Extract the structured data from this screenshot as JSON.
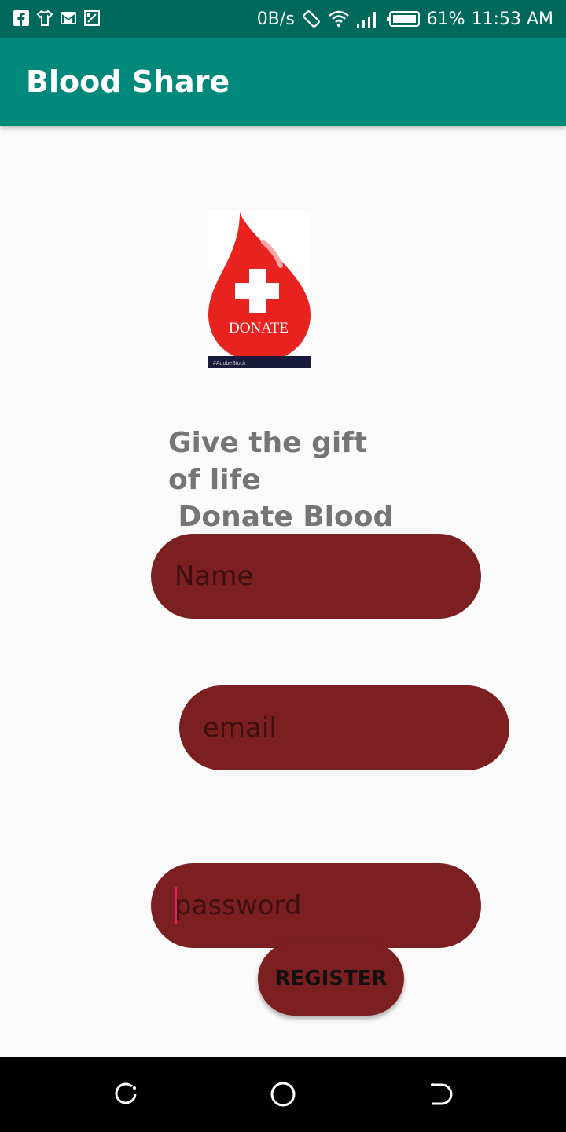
{
  "status_bar": {
    "net_speed": "0B/s",
    "battery": "61%",
    "time": "11:53 AM",
    "left_icons": [
      "facebook-icon",
      "tshirt-icon",
      "gmail-icon",
      "screenshot-icon"
    ],
    "right_icons": [
      "rotate-icon",
      "wifi-icon",
      "signal-icon",
      "battery-icon"
    ]
  },
  "app_bar": {
    "title": "Blood Share"
  },
  "logo": {
    "text": "DONATE",
    "footer_left": "#AdobeStock",
    "footer_right": ""
  },
  "tagline": "Give the gift\nof life\n Donate Blood",
  "form": {
    "name_placeholder": "Name",
    "email_placeholder": "email",
    "password_placeholder": "password",
    "register_label": "REGISTER"
  },
  "nav": {
    "icons": [
      "recent-apps-icon",
      "home-icon",
      "back-icon"
    ]
  },
  "colors": {
    "status": "#00695c",
    "app_bar": "#00897b",
    "field": "#7b1f20",
    "drop": "#e8221f"
  }
}
